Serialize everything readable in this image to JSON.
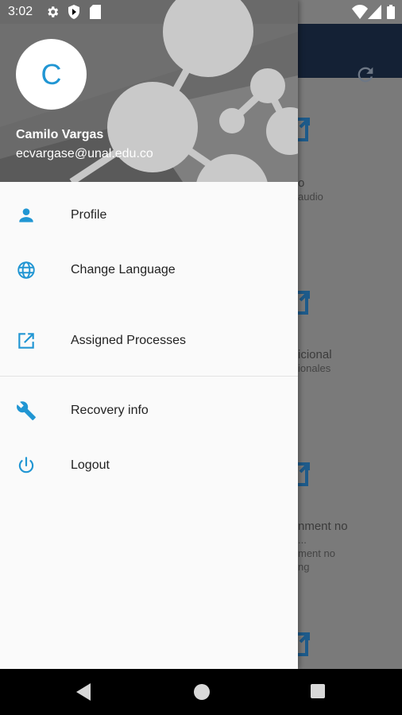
{
  "status_bar": {
    "time": "3:02"
  },
  "drawer": {
    "avatar_letter": "C",
    "user_name": "Camilo Vargas",
    "user_email": "ecvargase@unal.edu.co",
    "items": [
      {
        "label": "Profile",
        "icon": "person-icon"
      },
      {
        "label": "Change Language",
        "icon": "globe-icon"
      },
      {
        "label": "Assigned Processes",
        "icon": "open-in-new-icon"
      },
      {
        "label": "Recovery info",
        "icon": "wrench-icon"
      },
      {
        "label": "Logout",
        "icon": "power-icon"
      }
    ]
  },
  "background": {
    "items": [
      {
        "title": "o",
        "subtitle": "audio"
      },
      {
        "title": "icional",
        "subtitle": "ionales"
      },
      {
        "title": "nment no",
        "extra": "...",
        "subtitle": "ment no",
        "subtitle2": "ng"
      }
    ]
  },
  "colors": {
    "accent": "#2196d3",
    "toolbar": "#142135"
  }
}
